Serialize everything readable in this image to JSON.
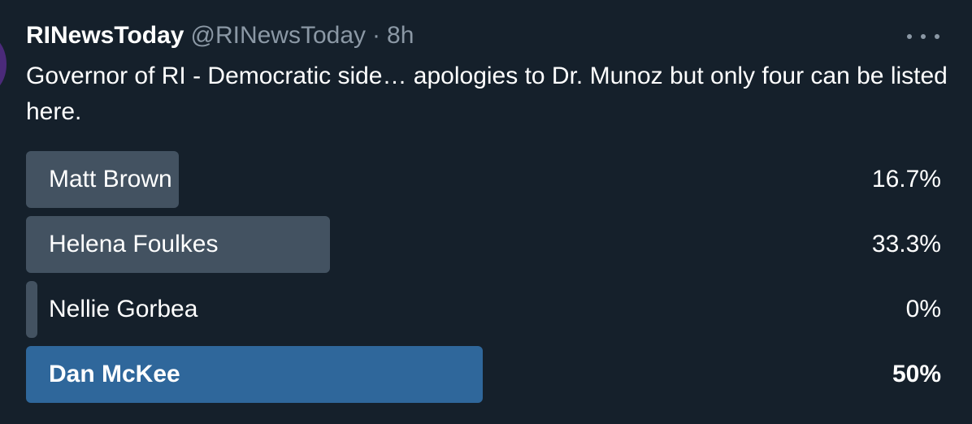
{
  "tweet": {
    "display_name": "RINewsToday",
    "handle": "@RINewsToday",
    "separator": "·",
    "time": "8h",
    "more_icon": "more-horizontal-icon",
    "text": "Governor of RI - Democratic side… apologies to Dr. Munoz but only four can be listed here."
  },
  "poll": {
    "options": [
      {
        "label": "Matt Brown",
        "percent_text": "16.7%",
        "percent": 16.7,
        "winner": false
      },
      {
        "label": "Helena Foulkes",
        "percent_text": "33.3%",
        "percent": 33.3,
        "winner": false
      },
      {
        "label": "Nellie Gorbea",
        "percent_text": "0%",
        "percent": 0,
        "winner": false
      },
      {
        "label": "Dan McKee",
        "percent_text": "50%",
        "percent": 50,
        "winner": true
      }
    ]
  },
  "colors": {
    "background": "#15202b",
    "bar": "#435261",
    "winner_bar": "#2f679b",
    "secondary_text": "#8b98a5"
  }
}
